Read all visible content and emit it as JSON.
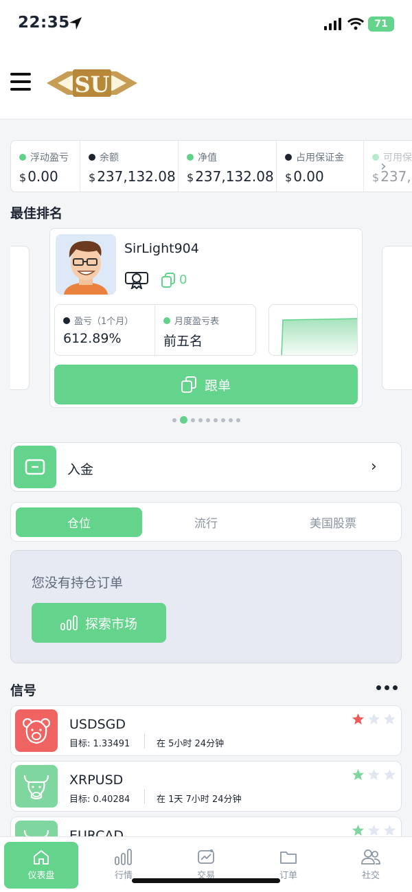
{
  "status_bar": {
    "time": "22:35",
    "battery": "71"
  },
  "header": {
    "logo_text": "SU"
  },
  "account_stats": [
    {
      "label": "浮动盈亏",
      "currency": "$",
      "value": "0.00",
      "dot_color": "#61d28a"
    },
    {
      "label": "余额",
      "currency": "$",
      "value": "237,132.08",
      "dot_color": "#1b2430"
    },
    {
      "label": "净值",
      "currency": "$",
      "value": "237,132.08",
      "dot_color": "#61d28a"
    },
    {
      "label": "占用保证金",
      "currency": "$",
      "value": "0.00",
      "dot_color": "#1b2430"
    },
    {
      "label": "可用保",
      "currency": "$",
      "value": "237,",
      "dot_color": "#61d28a"
    }
  ],
  "top_ranking": {
    "title": "最佳排名",
    "trader_name": "SirLight904",
    "copy_count": "0",
    "profit_label": "盈亏（1个月）",
    "profit_value": "612.89%",
    "monthly_label": "月度盈亏表",
    "monthly_value": "前五名",
    "copy_button": "跟单",
    "page_count": 9,
    "active_page": 2
  },
  "deposit": {
    "label": "入金"
  },
  "tabs": [
    {
      "label": "仓位",
      "active": true
    },
    {
      "label": "流行",
      "active": false
    },
    {
      "label": "美国股票",
      "active": false
    }
  ],
  "positions": {
    "empty_message": "您没有持仓订单",
    "explore_button": "探索市场"
  },
  "signals": {
    "title": "信号",
    "items": [
      {
        "symbol": "USDSGD",
        "target": "目标: 1.33491",
        "time": "在 5小时 24分钟",
        "icon": "bear-icon",
        "color": "#ef6363",
        "rating": 1
      },
      {
        "symbol": "XRPUSD",
        "target": "目标: 0.40284",
        "time": "在 1天 7小时 24分钟",
        "icon": "bull-icon",
        "color": "#7fd69f",
        "rating": 1
      },
      {
        "symbol": "EURCAD",
        "target": "",
        "time": "",
        "icon": "bull-icon",
        "color": "#7fd69f",
        "rating": 1
      }
    ]
  },
  "bottom_nav": [
    {
      "label": "仪表盘",
      "icon": "home-icon",
      "active": true
    },
    {
      "label": "行情",
      "icon": "bars-icon",
      "active": false
    },
    {
      "label": "交易",
      "icon": "chart-icon",
      "active": false
    },
    {
      "label": "订单",
      "icon": "folder-icon",
      "active": false
    },
    {
      "label": "社交",
      "icon": "people-icon",
      "active": false
    }
  ]
}
